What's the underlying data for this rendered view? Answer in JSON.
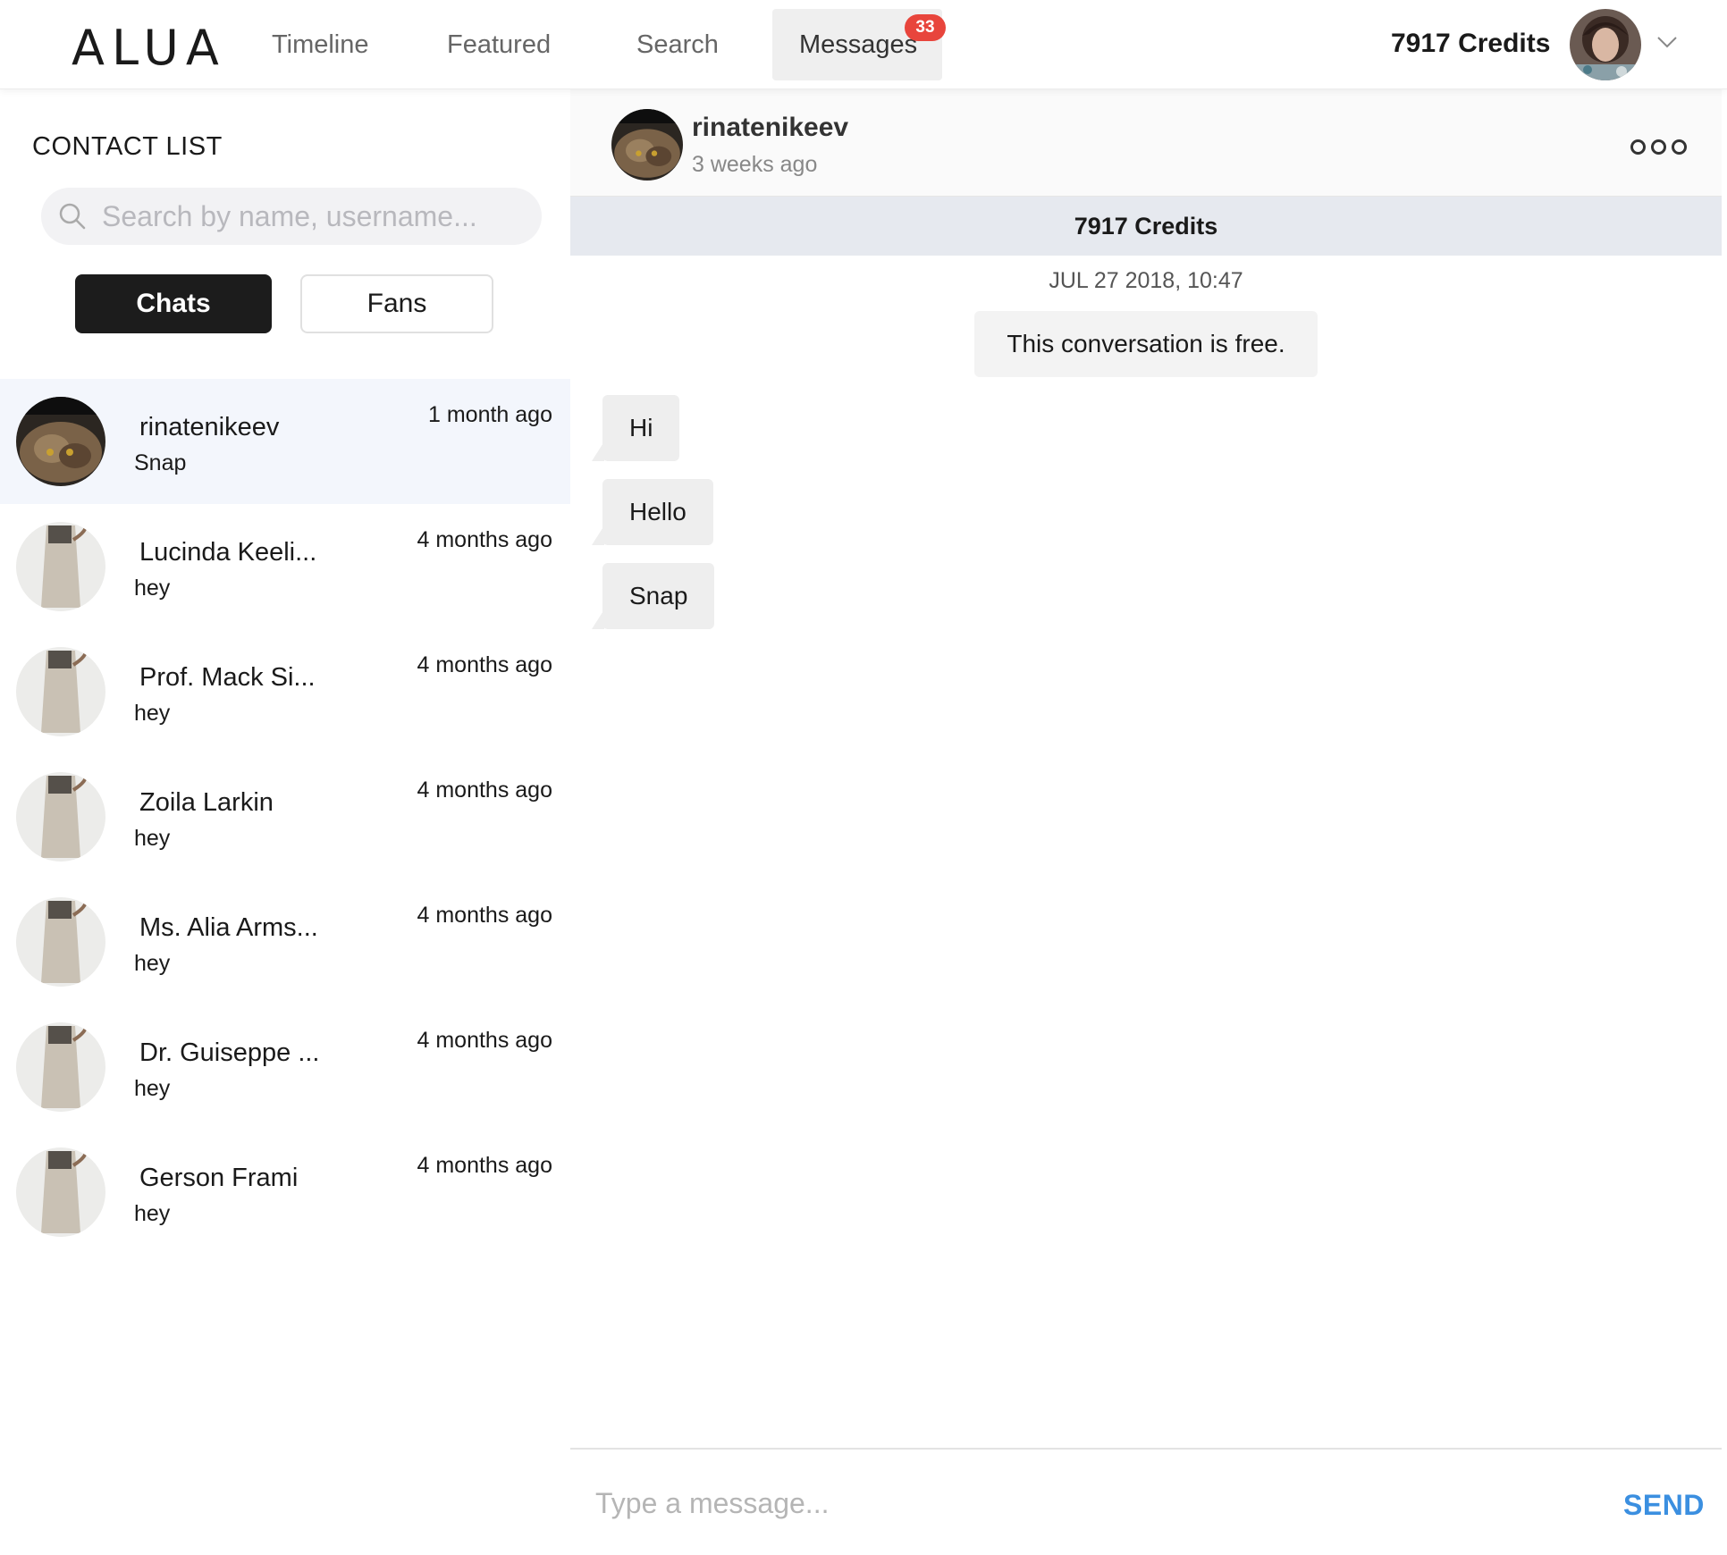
{
  "nav": {
    "logo": "ALUA",
    "items": [
      {
        "label": "Timeline"
      },
      {
        "label": "Featured"
      },
      {
        "label": "Search"
      },
      {
        "label": "Messages",
        "badge": "33"
      }
    ],
    "credits": "7917 Credits"
  },
  "contacts": {
    "title": "CONTACT LIST",
    "search_placeholder": "Search by name, username...",
    "tabs": {
      "chats": "Chats",
      "fans": "Fans"
    },
    "list": [
      {
        "name": "rinatenikeev",
        "last": "Snap",
        "time": "1 month ago",
        "avatar": "cat-avatar"
      },
      {
        "name": "Lucinda Keeli...",
        "last": "hey",
        "time": "4 months ago",
        "avatar": "dress-avatar"
      },
      {
        "name": "Prof. Mack Si...",
        "last": "hey",
        "time": "4 months ago",
        "avatar": "dress-avatar"
      },
      {
        "name": "Zoila Larkin",
        "last": "hey",
        "time": "4 months ago",
        "avatar": "dress-avatar"
      },
      {
        "name": "Ms. Alia Arms...",
        "last": "hey",
        "time": "4 months ago",
        "avatar": "dress-avatar"
      },
      {
        "name": "Dr. Guiseppe ...",
        "last": "hey",
        "time": "4 months ago",
        "avatar": "dress-avatar"
      },
      {
        "name": "Gerson Frami",
        "last": "hey",
        "time": "4 months ago",
        "avatar": "dress-avatar"
      }
    ]
  },
  "chat": {
    "header": {
      "name": "rinatenikeev",
      "sub": "3 weeks ago"
    },
    "credits_bar": "7917 Credits",
    "date": "JUL 27 2018, 10:47",
    "notice": "This conversation is free.",
    "messages": [
      {
        "text": "Hi"
      },
      {
        "text": "Hello"
      },
      {
        "text": "Snap"
      }
    ],
    "composer": {
      "placeholder": "Type a message...",
      "send": "SEND"
    }
  },
  "colors": {
    "badge": "#e8453c",
    "send": "#3b8fe0",
    "active_tab": "#1c1c1c",
    "selected_row": "#f3f6fc"
  },
  "icons": [
    "search-icon",
    "chevron-down-icon",
    "more-options-icon"
  ]
}
